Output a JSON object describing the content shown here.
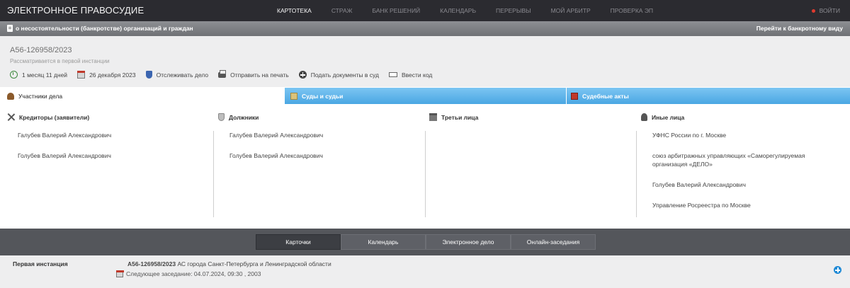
{
  "topnav": {
    "brand": "ЭЛЕКТРОННОЕ ПРАВОСУДИЕ",
    "links": [
      "КАРТОТЕКА",
      "СТРАЖ",
      "БАНК РЕШЕНИЙ",
      "КАЛЕНДАРЬ",
      "ПЕРЕРЫВЫ",
      "МОЙ АРБИТР",
      "ПРОВЕРКА ЭП"
    ],
    "active": "КАРТОТЕКА",
    "login": "ВОЙТИ"
  },
  "category": {
    "title": "о несостоятельности (банкротстве) организаций и граждан",
    "link": "Перейти к банкротному виду"
  },
  "case": {
    "number": "А56-126958/2023",
    "status": "Рассматривается в первой инстанции",
    "actions": {
      "duration": "1 месяц 11 дней",
      "date": "26 декабря 2023",
      "track": "Отслеживать дело",
      "print": "Отправить на печать",
      "submit": "Подать документы в суд",
      "code": "Ввести код"
    }
  },
  "tabs": {
    "participants": "Участники дела",
    "courts": "Суды и судьи",
    "acts": "Судебные акты"
  },
  "participants": {
    "creditors": {
      "heading": "Кредиторы (заявители)",
      "items": [
        "Галубев Валерий Александрович",
        "Голубев Валерий Александрович"
      ]
    },
    "debtors": {
      "heading": "Должники",
      "items": [
        "Галубев Валерий Александрович",
        "Голубев Валерий Александрович"
      ]
    },
    "third": {
      "heading": "Третьи лица",
      "items": []
    },
    "others": {
      "heading": "Иные лица",
      "items": [
        "УФНС России по г. Москве",
        "союз арбитражных управляющих «Саморегулируемая организация «ДЕЛО»",
        "Голубев Валерий Александрович",
        "Управление Росреестра по Москве"
      ]
    }
  },
  "bottom": {
    "tabs": [
      "Карточки",
      "Календарь",
      "Электронное дело",
      "Онлайн-заседания"
    ],
    "active": "Карточки",
    "instance": {
      "label": "Первая инстанция",
      "case_number": "А56-126958/2023",
      "court": "АС города Санкт-Петербурга и Ленинградской области",
      "next": "Следующее заседание: 04.07.2024, 09:30 , 2003"
    }
  }
}
